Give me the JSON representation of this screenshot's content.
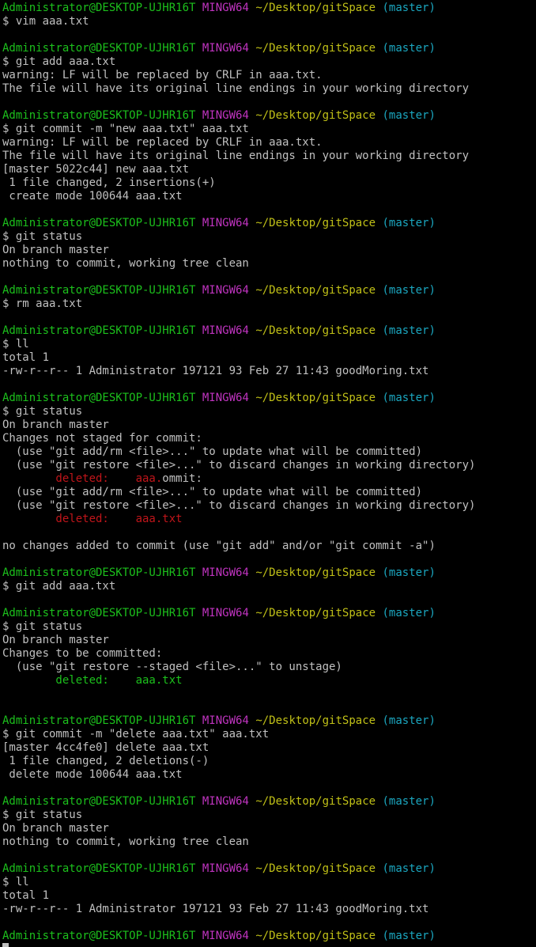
{
  "terminal": {
    "colors": {
      "user": "#1cc01c",
      "shell": "#c034c0",
      "path": "#c0c017",
      "branch": "#1ba7c0",
      "deleted_unstaged": "#c0151a",
      "deleted_staged": "#1cc01c",
      "text": "#c0c0c0",
      "background": "#000000"
    },
    "lines": [
      {
        "type": "prompt",
        "user": "Administrator@DESKTOP-UJHR16T",
        "shell": "MINGW64",
        "path": "~/Desktop/gitSpace",
        "branch": "(master)"
      },
      {
        "type": "command",
        "text": "$ vim aaa.txt"
      },
      {
        "type": "blank"
      },
      {
        "type": "prompt",
        "user": "Administrator@DESKTOP-UJHR16T",
        "shell": "MINGW64",
        "path": "~/Desktop/gitSpace",
        "branch": "(master)"
      },
      {
        "type": "command",
        "text": "$ git add aaa.txt"
      },
      {
        "type": "output",
        "text": "warning: LF will be replaced by CRLF in aaa.txt."
      },
      {
        "type": "output",
        "text": "The file will have its original line endings in your working directory"
      },
      {
        "type": "blank"
      },
      {
        "type": "prompt",
        "user": "Administrator@DESKTOP-UJHR16T",
        "shell": "MINGW64",
        "path": "~/Desktop/gitSpace",
        "branch": "(master)"
      },
      {
        "type": "command",
        "text": "$ git commit -m \"new aaa.txt\" aaa.txt"
      },
      {
        "type": "output",
        "text": "warning: LF will be replaced by CRLF in aaa.txt."
      },
      {
        "type": "output",
        "text": "The file will have its original line endings in your working directory"
      },
      {
        "type": "output",
        "text": "[master 5022c44] new aaa.txt"
      },
      {
        "type": "output",
        "text": " 1 file changed, 2 insertions(+)"
      },
      {
        "type": "output",
        "text": " create mode 100644 aaa.txt"
      },
      {
        "type": "blank"
      },
      {
        "type": "prompt",
        "user": "Administrator@DESKTOP-UJHR16T",
        "shell": "MINGW64",
        "path": "~/Desktop/gitSpace",
        "branch": "(master)"
      },
      {
        "type": "command",
        "text": "$ git status"
      },
      {
        "type": "output",
        "text": "On branch master"
      },
      {
        "type": "output",
        "text": "nothing to commit, working tree clean"
      },
      {
        "type": "blank"
      },
      {
        "type": "prompt",
        "user": "Administrator@DESKTOP-UJHR16T",
        "shell": "MINGW64",
        "path": "~/Desktop/gitSpace",
        "branch": "(master)"
      },
      {
        "type": "command",
        "text": "$ rm aaa.txt"
      },
      {
        "type": "blank"
      },
      {
        "type": "prompt",
        "user": "Administrator@DESKTOP-UJHR16T",
        "shell": "MINGW64",
        "path": "~/Desktop/gitSpace",
        "branch": "(master)"
      },
      {
        "type": "command",
        "text": "$ ll"
      },
      {
        "type": "output",
        "text": "total 1"
      },
      {
        "type": "output",
        "text": "-rw-r--r-- 1 Administrator 197121 93 Feb 27 11:43 goodMoring.txt"
      },
      {
        "type": "blank"
      },
      {
        "type": "prompt",
        "user": "Administrator@DESKTOP-UJHR16T",
        "shell": "MINGW64",
        "path": "~/Desktop/gitSpace",
        "branch": "(master)"
      },
      {
        "type": "command",
        "text": "$ git status"
      },
      {
        "type": "output",
        "text": "On branch master"
      },
      {
        "type": "output",
        "text": "Changes not staged for commit:"
      },
      {
        "type": "output",
        "text": "  (use \"git add/rm <file>...\" to update what will be committed)"
      },
      {
        "type": "output",
        "text": "  (use \"git restore <file>...\" to discard changes in working directory)"
      },
      {
        "type": "mixed",
        "segments": [
          {
            "text": "        deleted:    aaa.",
            "color": "red"
          },
          {
            "text": "ommit:",
            "color": "white"
          }
        ]
      },
      {
        "type": "output",
        "text": "  (use \"git add/rm <file>...\" to update what will be committed)"
      },
      {
        "type": "output",
        "text": "  (use \"git restore <file>...\" to discard changes in working directory)"
      },
      {
        "type": "mixed",
        "segments": [
          {
            "text": "        deleted:    aaa.txt",
            "color": "red"
          }
        ]
      },
      {
        "type": "blank"
      },
      {
        "type": "output",
        "text": "no changes added to commit (use \"git add\" and/or \"git commit -a\")"
      },
      {
        "type": "blank"
      },
      {
        "type": "prompt",
        "user": "Administrator@DESKTOP-UJHR16T",
        "shell": "MINGW64",
        "path": "~/Desktop/gitSpace",
        "branch": "(master)"
      },
      {
        "type": "command",
        "text": "$ git add aaa.txt"
      },
      {
        "type": "blank"
      },
      {
        "type": "prompt",
        "user": "Administrator@DESKTOP-UJHR16T",
        "shell": "MINGW64",
        "path": "~/Desktop/gitSpace",
        "branch": "(master)"
      },
      {
        "type": "command",
        "text": "$ git status"
      },
      {
        "type": "output",
        "text": "On branch master"
      },
      {
        "type": "output",
        "text": "Changes to be committed:"
      },
      {
        "type": "output",
        "text": "  (use \"git restore --staged <file>...\" to unstage)"
      },
      {
        "type": "mixed",
        "segments": [
          {
            "text": "        deleted:    aaa.txt",
            "color": "green"
          }
        ]
      },
      {
        "type": "blank"
      },
      {
        "type": "blank"
      },
      {
        "type": "prompt",
        "user": "Administrator@DESKTOP-UJHR16T",
        "shell": "MINGW64",
        "path": "~/Desktop/gitSpace",
        "branch": "(master)"
      },
      {
        "type": "command",
        "text": "$ git commit -m \"delete aaa.txt\" aaa.txt"
      },
      {
        "type": "output",
        "text": "[master 4cc4fe0] delete aaa.txt"
      },
      {
        "type": "output",
        "text": " 1 file changed, 2 deletions(-)"
      },
      {
        "type": "output",
        "text": " delete mode 100644 aaa.txt"
      },
      {
        "type": "blank"
      },
      {
        "type": "prompt",
        "user": "Administrator@DESKTOP-UJHR16T",
        "shell": "MINGW64",
        "path": "~/Desktop/gitSpace",
        "branch": "(master)"
      },
      {
        "type": "command",
        "text": "$ git status"
      },
      {
        "type": "output",
        "text": "On branch master"
      },
      {
        "type": "output",
        "text": "nothing to commit, working tree clean"
      },
      {
        "type": "blank"
      },
      {
        "type": "prompt",
        "user": "Administrator@DESKTOP-UJHR16T",
        "shell": "MINGW64",
        "path": "~/Desktop/gitSpace",
        "branch": "(master)"
      },
      {
        "type": "command",
        "text": "$ ll"
      },
      {
        "type": "output",
        "text": "total 1"
      },
      {
        "type": "output",
        "text": "-rw-r--r-- 1 Administrator 197121 93 Feb 27 11:43 goodMoring.txt"
      },
      {
        "type": "blank"
      },
      {
        "type": "prompt",
        "user": "Administrator@DESKTOP-UJHR16T",
        "shell": "MINGW64",
        "path": "~/Desktop/gitSpace",
        "branch": "(master)"
      }
    ]
  }
}
